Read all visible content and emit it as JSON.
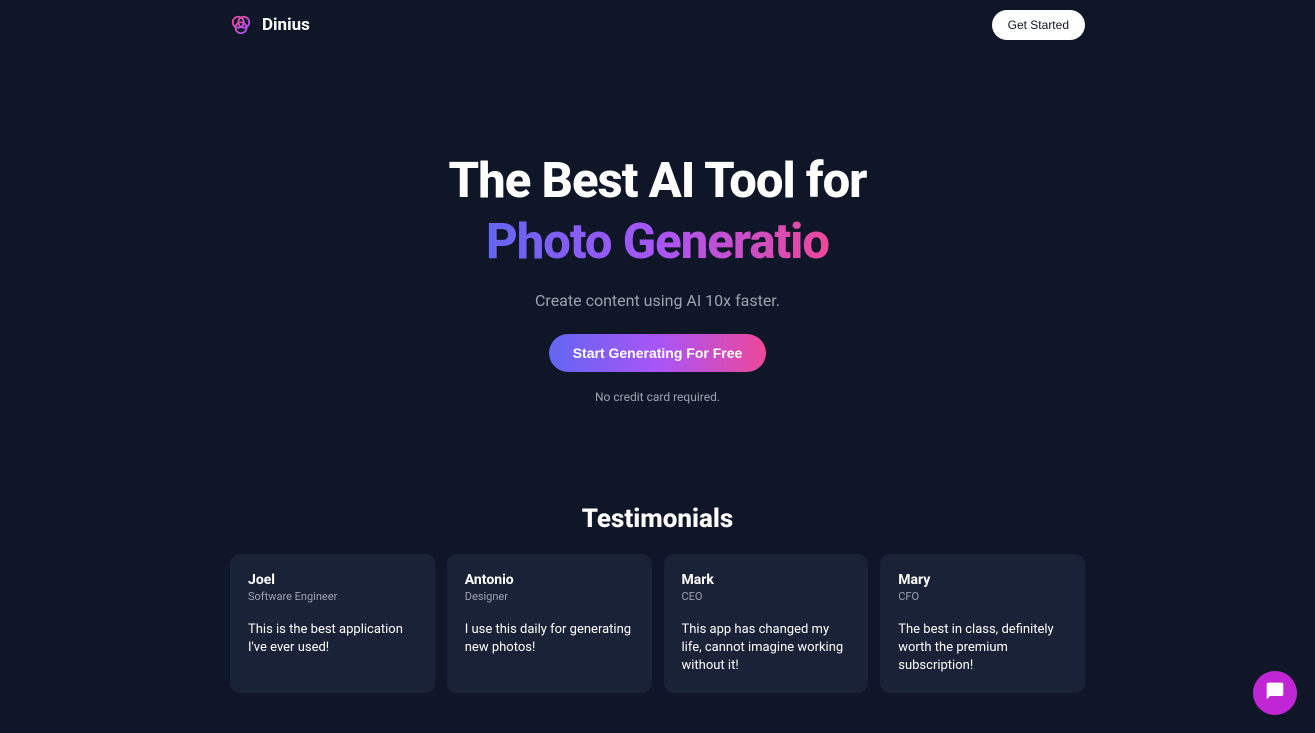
{
  "header": {
    "brand": "Dinius",
    "get_started": "Get Started"
  },
  "hero": {
    "title_line1": "The Best AI Tool for",
    "title_line2": "Photo Generatio",
    "subtitle": "Create content using AI 10x faster.",
    "cta": "Start Generating For Free",
    "note": "No credit card required."
  },
  "testimonials": {
    "title": "Testimonials",
    "items": [
      {
        "name": "Joel",
        "role": "Software Engineer",
        "quote": "This is the best application I've ever used!"
      },
      {
        "name": "Antonio",
        "role": "Designer",
        "quote": "I use this daily for generating new photos!"
      },
      {
        "name": "Mark",
        "role": "CEO",
        "quote": "This app has changed my life, cannot imagine working without it!"
      },
      {
        "name": "Mary",
        "role": "CFO",
        "quote": "The best in class, definitely worth the premium subscription!"
      }
    ]
  }
}
